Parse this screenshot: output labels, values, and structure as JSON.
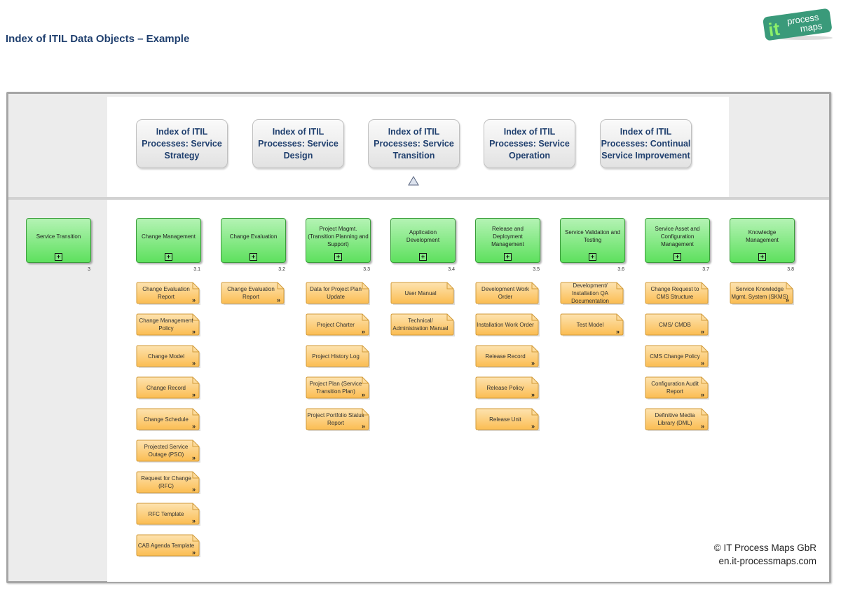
{
  "page": {
    "title": "Index of ITIL Data Objects – Example",
    "logo": {
      "big": "it",
      "line1": "process",
      "line2": "maps",
      "color": "#3a9a7a",
      "accent": "#8cf06a"
    },
    "copyright": [
      "© IT Process Maps GbR",
      "en.it-processmaps.com"
    ]
  },
  "index_links": [
    {
      "label": "Index of ITIL Processes: Service Strategy"
    },
    {
      "label": "Index of ITIL Processes: Service Design"
    },
    {
      "label": "Index of ITIL Processes: Service Transition"
    },
    {
      "label": "Index of ITIL Processes: Service Operation"
    },
    {
      "label": "Index of ITIL Processes: Continual Service Improvement"
    }
  ],
  "current_marker": "triangle-up-under-service-transition",
  "main_process": {
    "label": "Service Transition",
    "number": "3"
  },
  "processes": [
    {
      "label": "Change Management",
      "number": "3.1",
      "objects": [
        "Change Evaluation Report",
        "Change Management Policy",
        "Change Model",
        "Change Record",
        "Change Schedule",
        "Projected Service Outage (PSO)",
        "Request for Change (RFC)",
        "RFC Template",
        "CAB Agenda Template"
      ],
      "linked": [
        true,
        true,
        true,
        true,
        true,
        true,
        true,
        true,
        true
      ]
    },
    {
      "label": "Change Evaluation",
      "number": "3.2",
      "objects": [
        "Change Evaluation Report"
      ],
      "linked": [
        true
      ]
    },
    {
      "label": "Project Magmt. (Transition Planning and Support)",
      "number": "3.3",
      "objects": [
        "Data for Project Plan Update",
        "Project Charter",
        "Project History Log",
        "Project Plan (Service Transition Plan)",
        "Project Portfolio Status Report"
      ],
      "linked": [
        false,
        true,
        false,
        true,
        true
      ]
    },
    {
      "label": "Application Development",
      "number": "3.4",
      "objects": [
        "User Manual",
        "Technical/ Administration Manual"
      ],
      "linked": [
        false,
        false
      ]
    },
    {
      "label": "Release and Deployment Management",
      "number": "3.5",
      "objects": [
        "Development Work Order",
        "Installation Work Order",
        "Release Record",
        "Release Policy",
        "Release Unit"
      ],
      "linked": [
        false,
        false,
        true,
        true,
        true
      ]
    },
    {
      "label": "Service Validation and Testing",
      "number": "3.6",
      "objects": [
        "Development/ Installation QA Documentation",
        "Test Model"
      ],
      "linked": [
        false,
        true
      ]
    },
    {
      "label": "Service Asset and Configuration Management",
      "number": "3.7",
      "objects": [
        "Change Request to CMS Structure",
        "CMS/ CMDB",
        "CMS Change Policy",
        "Configuration Audit Report",
        "Definitive Media Library (DML)"
      ],
      "linked": [
        false,
        true,
        true,
        true,
        true
      ]
    },
    {
      "label": "Knowledge Management",
      "number": "3.8",
      "objects": [
        "Service Knowledge Mgmt. System (SKMS)"
      ],
      "linked": [
        true
      ]
    }
  ],
  "icons": {
    "expand": "+",
    "link": "»"
  },
  "colors": {
    "process_fill": "#5ee05e",
    "object_fill": "#fcc45e",
    "title_blue": "#1f3f6e"
  }
}
